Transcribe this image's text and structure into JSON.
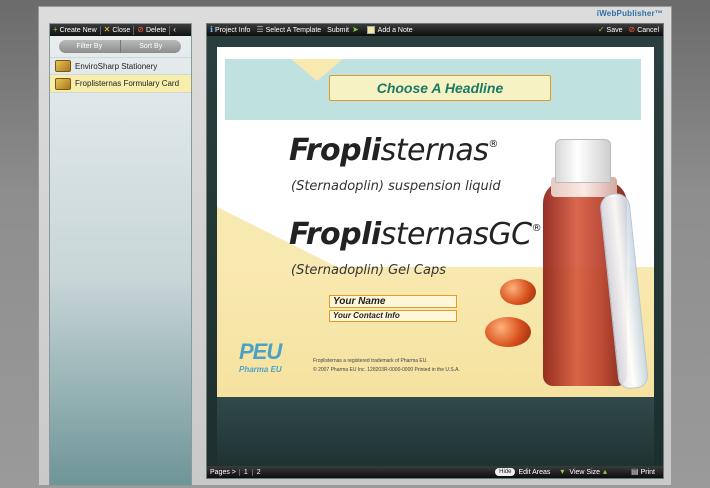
{
  "brand": "iWebPublisher™",
  "left_toolbar": {
    "create_new": "Create New",
    "close": "Close",
    "delete": "Delete",
    "collapse": "‹"
  },
  "filter": {
    "filter_by": "Filter By",
    "sort_by": "Sort By"
  },
  "projects": [
    {
      "label": "EnviroSharp Stationery",
      "selected": false
    },
    {
      "label": "Froplisternas Formulary Card",
      "selected": true
    }
  ],
  "right_toolbar": {
    "project_info": "Project Info",
    "select_template": "Select A Template",
    "submit": "Submit",
    "add_note": "Add a Note",
    "save": "Save",
    "cancel": "Cancel"
  },
  "document": {
    "headline": "Choose A Headline",
    "drug1_bold": "Fropli",
    "drug1_light": "sternas",
    "drug1_mark": "®",
    "drug1_sub": "(Sternadoplin) suspension liquid",
    "drug2_bold": "Fropli",
    "drug2_light": "sternasGC",
    "drug2_mark": "®",
    "drug2_sub": "(Sternadoplin) Gel Caps",
    "your_name": "Your Name",
    "contact_info": "Your Contact Info",
    "logo_text": "PEU",
    "logo_sub": "Pharma EU",
    "fine1": "Froplisternas a registered trademark of Pharma EU.",
    "fine2": "© 2007 Pharma EU Inc.    128203R-0000-0000       Printed in the U.S.A."
  },
  "bottom_bar": {
    "pages_label": "Pages >",
    "pages": [
      "1",
      "2"
    ],
    "hide": "Hide",
    "edit_areas": "Edit Areas",
    "view_size": "View Size",
    "print": "Print"
  }
}
